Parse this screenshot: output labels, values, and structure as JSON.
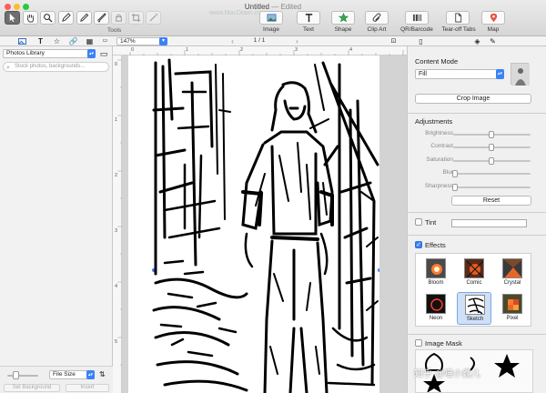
{
  "window": {
    "title": "Untitled",
    "edited": "— Edited",
    "url_overlay": "www.MacDown.com"
  },
  "colors": {
    "close": "#fe5f57",
    "minimize": "#febc2e",
    "zoom": "#28c840",
    "accent": "#3b82f6"
  },
  "toolbar": {
    "tools_label": "Tools",
    "tools": [
      "select-arrow-icon",
      "hand-icon",
      "magnifier-icon",
      "pen-icon",
      "pencil-icon",
      "brush-icon",
      "lock-icon",
      "crop-icon",
      "wand-icon"
    ],
    "insert": [
      {
        "label": "Image",
        "icon": "image-icon"
      },
      {
        "label": "Text",
        "icon": "text-icon"
      },
      {
        "label": "Shape",
        "icon": "star-icon"
      },
      {
        "label": "Clip Art",
        "icon": "paperclip-icon"
      },
      {
        "label": "QR/Barcode",
        "icon": "barcode-icon"
      },
      {
        "label": "Tear-off Tabs",
        "icon": "document-icon"
      },
      {
        "label": "Map",
        "icon": "map-pin-icon"
      }
    ]
  },
  "subbar": {
    "zoom": "147%",
    "page": "1 / 1"
  },
  "left_panel": {
    "source": "Photos Library",
    "search_placeholder": "Stock photos, backgrounds...",
    "file_size": "File Size",
    "set_background": "Set Background",
    "insert": "Insert"
  },
  "rulers": {
    "top": [
      "0",
      "1",
      "2",
      "3",
      "4"
    ],
    "left": [
      "0",
      "1",
      "2",
      "3",
      "4",
      "5"
    ]
  },
  "right_panel": {
    "content_mode_label": "Content Mode",
    "content_mode_value": "Fill",
    "crop_image": "Crop Image",
    "adjustments_label": "Adjustments",
    "adjustments": [
      {
        "label": "Brightness",
        "value": 0.5
      },
      {
        "label": "Contrast",
        "value": 0.5
      },
      {
        "label": "Saturation",
        "value": 0.5
      },
      {
        "label": "Blur",
        "value": 0.0
      },
      {
        "label": "Sharpness",
        "value": 0.0
      }
    ],
    "reset": "Reset",
    "tint_label": "Tint",
    "effects_label": "Effects",
    "effects": [
      "Bloom",
      "Comic",
      "Crystal",
      "Neon",
      "Sketch",
      "Pixel"
    ],
    "selected_effect": "Sketch",
    "image_mask_label": "Image Mask"
  },
  "watermark": "知乎 @喵小鑫儿"
}
